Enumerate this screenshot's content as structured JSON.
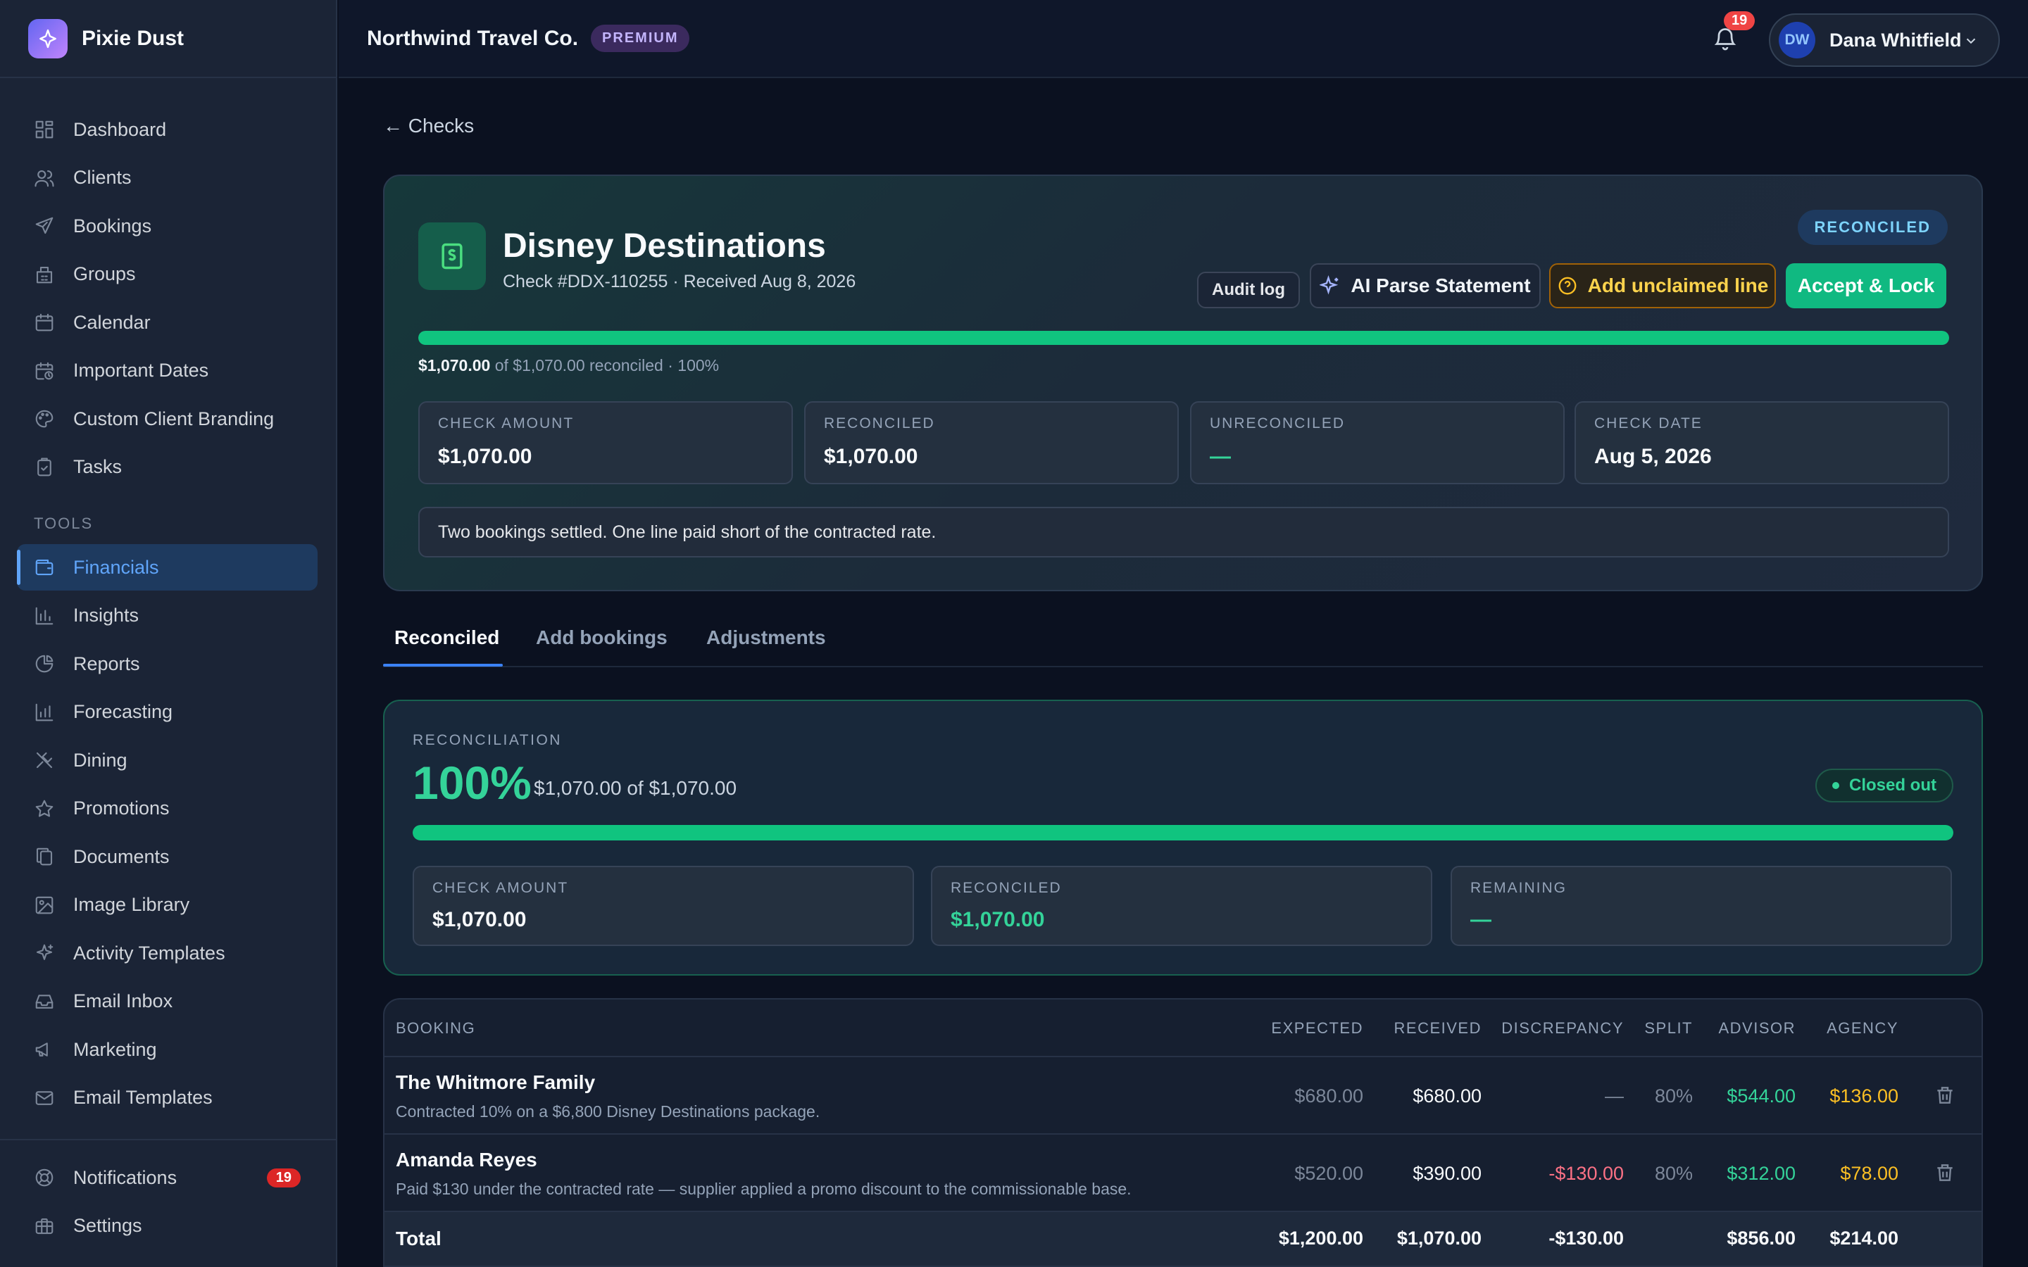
{
  "brand": {
    "name": "Pixie Dust"
  },
  "sidebar": {
    "items": [
      {
        "label": "Dashboard",
        "icon": "grid-icon"
      },
      {
        "label": "Clients",
        "icon": "users-icon"
      },
      {
        "label": "Bookings",
        "icon": "plane-icon"
      },
      {
        "label": "Groups",
        "icon": "building-icon"
      },
      {
        "label": "Calendar",
        "icon": "calendar-icon"
      },
      {
        "label": "Important Dates",
        "icon": "calendar-clock-icon"
      },
      {
        "label": "Custom Client Branding",
        "icon": "palette-icon"
      },
      {
        "label": "Tasks",
        "icon": "clipboard-icon"
      }
    ],
    "tools_heading": "TOOLS",
    "tools": [
      {
        "label": "Financials",
        "icon": "wallet-icon",
        "active": true
      },
      {
        "label": "Insights",
        "icon": "bar-chart-icon"
      },
      {
        "label": "Reports",
        "icon": "pie-chart-icon"
      },
      {
        "label": "Forecasting",
        "icon": "bar-chart-icon"
      },
      {
        "label": "Dining",
        "icon": "utensils-icon"
      },
      {
        "label": "Promotions",
        "icon": "star-icon"
      },
      {
        "label": "Documents",
        "icon": "files-icon"
      },
      {
        "label": "Image Library",
        "icon": "image-icon"
      },
      {
        "label": "Activity Templates",
        "icon": "sparkle-icon"
      },
      {
        "label": "Email Inbox",
        "icon": "inbox-icon"
      },
      {
        "label": "Marketing",
        "icon": "megaphone-icon"
      },
      {
        "label": "Email Templates",
        "icon": "mail-icon"
      }
    ],
    "bottom": [
      {
        "label": "Notifications",
        "icon": "lifebuoy-icon",
        "badge": "19"
      },
      {
        "label": "Settings",
        "icon": "briefcase-icon"
      }
    ]
  },
  "topbar": {
    "org_name": "Northwind Travel Co.",
    "plan_badge": "PREMIUM",
    "notification_count": "19",
    "user": {
      "initials": "DW",
      "name": "Dana Whitfield"
    }
  },
  "back_link": "← Checks",
  "check": {
    "payer": "Disney Destinations",
    "subtitle": "Check #DDX-110255 · Received Aug 8, 2026",
    "status": "RECONCILED",
    "actions": {
      "audit_log": "Audit log",
      "ai_parse": "AI Parse Statement",
      "add_unclaimed": "Add unclaimed line",
      "accept_lock": "Accept & Lock"
    },
    "progress_fraction": 1.0,
    "progress_reconciled": "$1,070.00",
    "progress_rest": "of $1,070.00 reconciled · 100%",
    "stats": [
      {
        "label": "CHECK AMOUNT",
        "value": "$1,070.00"
      },
      {
        "label": "RECONCILED",
        "value": "$1,070.00"
      },
      {
        "label": "UNRECONCILED",
        "value": "—"
      },
      {
        "label": "CHECK DATE",
        "value": "Aug 5, 2026"
      }
    ],
    "note": "Two bookings settled. One line paid short of the contracted rate."
  },
  "tabs": [
    {
      "label": "Reconciled",
      "active": true
    },
    {
      "label": "Add bookings"
    },
    {
      "label": "Adjustments"
    }
  ],
  "reconciliation": {
    "label": "RECONCILIATION",
    "percent": "100%",
    "summary": "$1,070.00 of $1,070.00",
    "status": "Closed out",
    "fraction": 1.0,
    "cards": [
      {
        "label": "CHECK AMOUNT",
        "value": "$1,070.00"
      },
      {
        "label": "RECONCILED",
        "value": "$1,070.00"
      },
      {
        "label": "REMAINING",
        "value": "—"
      }
    ]
  },
  "table": {
    "columns": [
      "BOOKING",
      "EXPECTED",
      "RECEIVED",
      "DISCREPANCY",
      "SPLIT",
      "ADVISOR",
      "AGENCY"
    ],
    "rows": [
      {
        "title": "The Whitmore Family",
        "desc": "Contracted 10% on a $6,800 Disney Destinations package.",
        "expected": "$680.00",
        "received": "$680.00",
        "discrepancy": "—",
        "split": "80%",
        "advisor": "$544.00",
        "agency": "$136.00"
      },
      {
        "title": "Amanda Reyes",
        "desc": "Paid $130 under the contracted rate — supplier applied a promo discount to the commissionable base.",
        "expected": "$520.00",
        "received": "$390.00",
        "discrepancy": "-$130.00",
        "split": "80%",
        "advisor": "$312.00",
        "agency": "$78.00"
      }
    ],
    "total": {
      "label": "Total",
      "expected": "$1,200.00",
      "received": "$1,070.00",
      "discrepancy": "-$130.00",
      "advisor": "$856.00",
      "agency": "$214.00"
    }
  },
  "colors": {
    "accent": "#60a5fa",
    "success": "#10c47f",
    "warning": "#fbbf24",
    "danger": "#fb7185"
  }
}
